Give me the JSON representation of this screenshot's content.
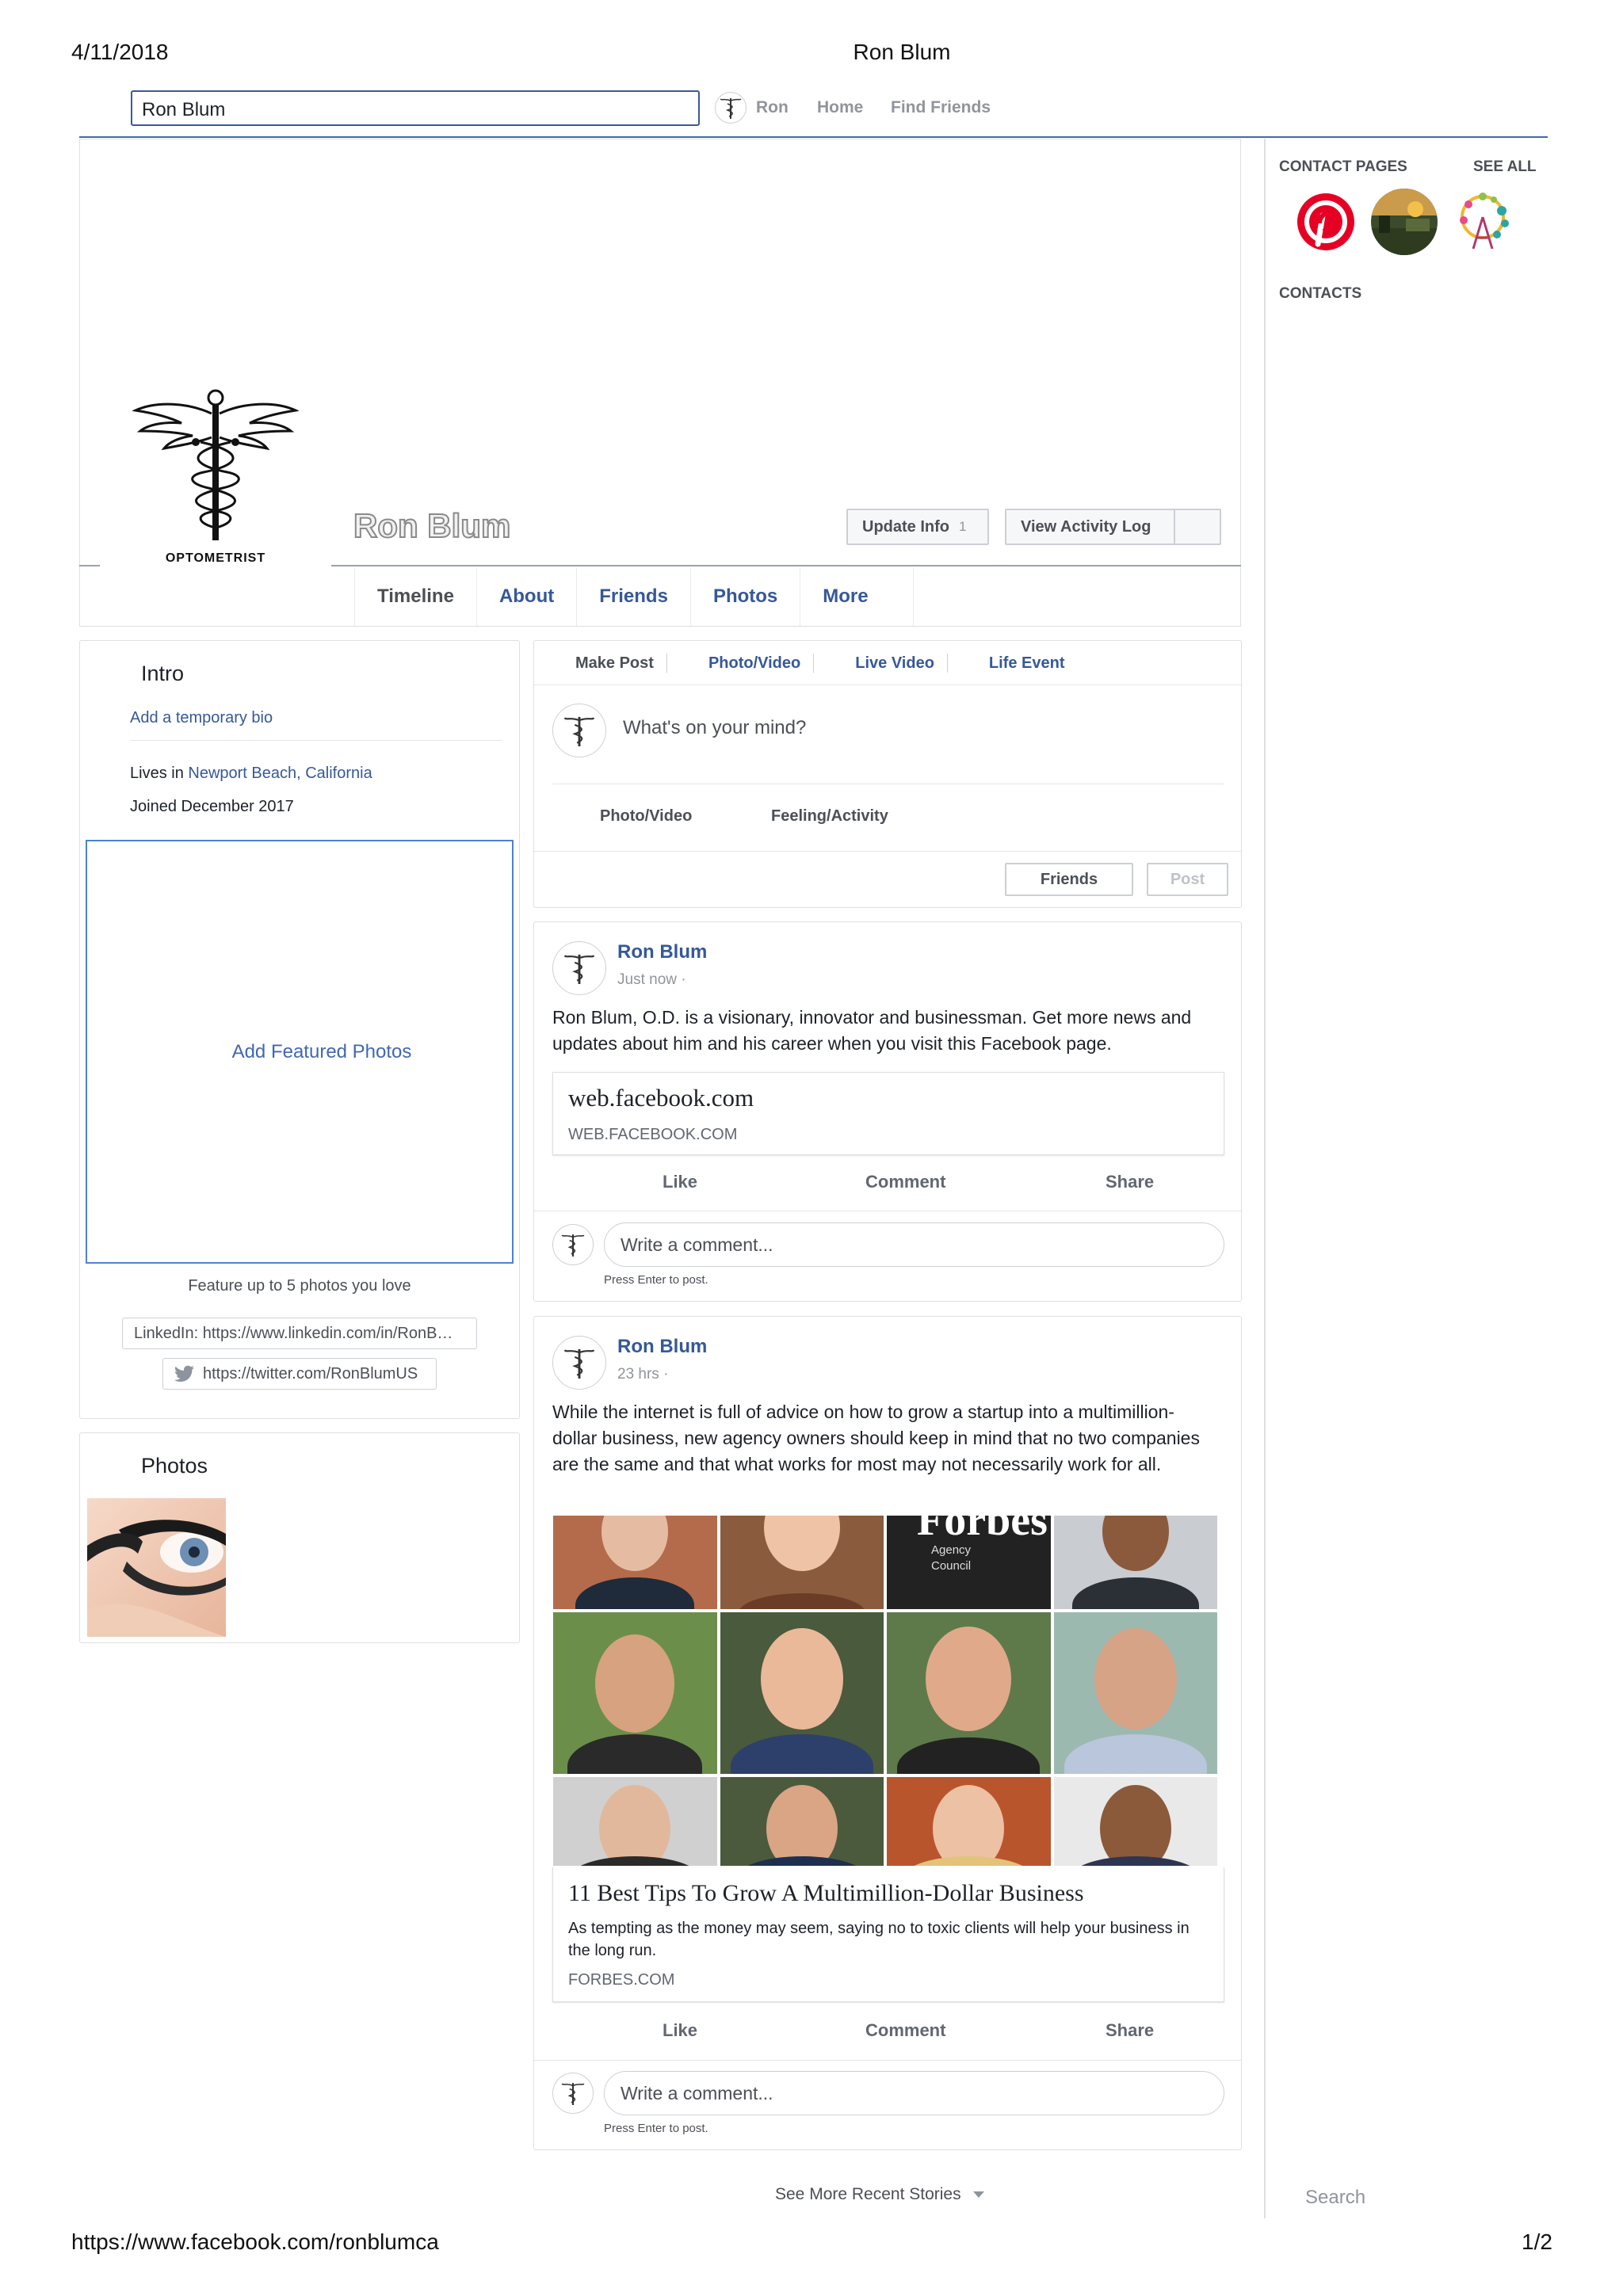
{
  "print_header": {
    "date": "4/11/2018",
    "title": "Ron Blum"
  },
  "print_footer": {
    "url": "https://www.facebook.com/ronblumca",
    "page": "1/2"
  },
  "topbar": {
    "search_value": "Ron Blum",
    "nav": {
      "profile": "Ron",
      "home": "Home",
      "find_friends": "Find Friends"
    }
  },
  "profile": {
    "name": "Ron Blum",
    "picture_caption": "OPTOMETRIST",
    "update_info": "Update Info",
    "update_info_badge": "1",
    "view_activity_log": "View Activity Log",
    "tabs": [
      "Timeline",
      "About",
      "Friends",
      "Photos",
      "More"
    ]
  },
  "intro": {
    "title": "Intro",
    "add_bio": "Add a temporary bio",
    "lives_prefix": "Lives in ",
    "lives_place": "Newport Beach, California",
    "joined": "Joined December 2017",
    "add_featured": "Add Featured Photos",
    "featured_note": "Feature up to 5 photos you love",
    "linkedin": "LinkedIn: https://www.linkedin.com/in/RonB…",
    "twitter": "https://twitter.com/RonBlumUS"
  },
  "photos": {
    "title": "Photos"
  },
  "composer": {
    "tabs": [
      "Make Post",
      "Photo/Video",
      "Live Video",
      "Life Event"
    ],
    "placeholder": "What's on your mind?",
    "actions": [
      "Photo/Video",
      "Feeling/Activity"
    ],
    "audience": "Friends",
    "post": "Post"
  },
  "posts": [
    {
      "author": "Ron Blum",
      "time": "Just now ·",
      "body": "Ron Blum, O.D. is a visionary, innovator and businessman. Get more news and updates about him and his career when you visit this Facebook page.",
      "link_title": "web.facebook.com",
      "link_domain": "WEB.FACEBOOK.COM",
      "actions": [
        "Like",
        "Comment",
        "Share"
      ],
      "comment_placeholder": "Write a comment...",
      "press_enter": "Press Enter to post."
    },
    {
      "author": "Ron Blum",
      "time": "23 hrs ·",
      "body": "While the internet is full of advice on how to grow a startup into a multimillion-dollar business, new agency owners should keep in mind that no two companies are the same and that what works for most may not necessarily work for all.",
      "image_brand": "Forbes",
      "image_sub": [
        "Agency",
        "Council"
      ],
      "link_title": "11 Best Tips To Grow A Multimillion-Dollar Business",
      "link_desc": "As tempting as the money may seem, saying no to toxic clients will help your business in the long run.",
      "link_domain": "FORBES.COM",
      "actions": [
        "Like",
        "Comment",
        "Share"
      ],
      "comment_placeholder": "Write a comment...",
      "press_enter": "Press Enter to post."
    }
  ],
  "see_more": "See More Recent Stories",
  "sidebar": {
    "contact_pages": "CONTACT PAGES",
    "see_all": "SEE ALL",
    "contacts": "CONTACTS",
    "search": "Search",
    "icons": [
      "pinterest-icon",
      "sunset-photo-icon",
      "ferris-wheel-icon"
    ]
  },
  "colors": {
    "fb_blue": "#365899",
    "topbar_line": "#4267b2",
    "pinterest_red": "#e60023"
  }
}
